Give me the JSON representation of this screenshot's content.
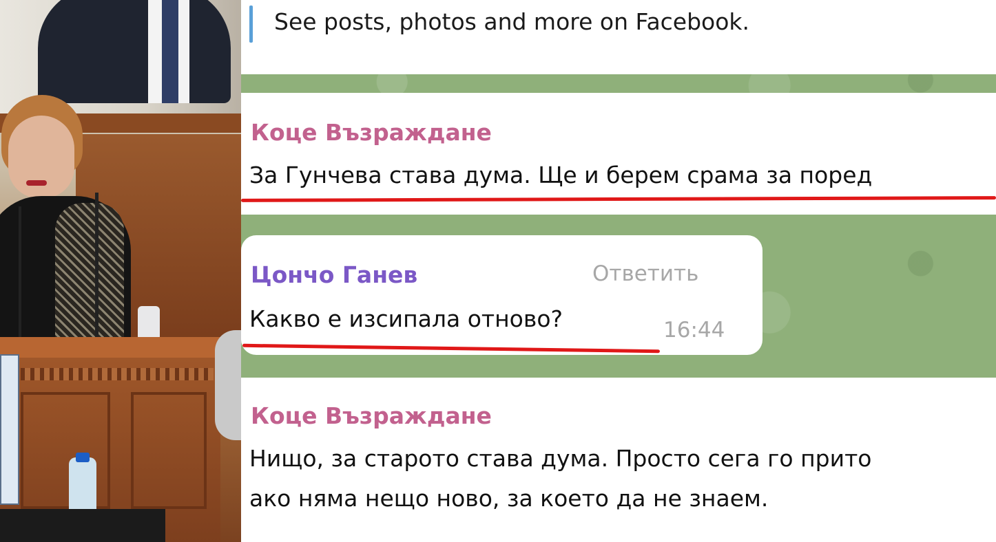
{
  "facebook_preview": {
    "text": "See posts, photos and more on Facebook."
  },
  "messages": [
    {
      "sender": "Коце Възраждане",
      "text": "За Гунчева става дума. Ще и берем срама за поред"
    },
    {
      "sender": "Цончо Ганев",
      "reply_label": "Ответить",
      "text": "Какво е изсипала отново?",
      "time": "16:44"
    },
    {
      "sender": "Коце Възраждане",
      "lines": [
        "Нищо, за старото става дума. Просто сега го прито",
        "ако няма нещо ново, за което да не знаем."
      ]
    }
  ],
  "colors": {
    "sender_pink": "#c2618e",
    "sender_purple": "#7b58c6",
    "chat_background": "#8fb07a",
    "underline_red": "#e01818",
    "quote_bar": "#5aa0d8"
  }
}
